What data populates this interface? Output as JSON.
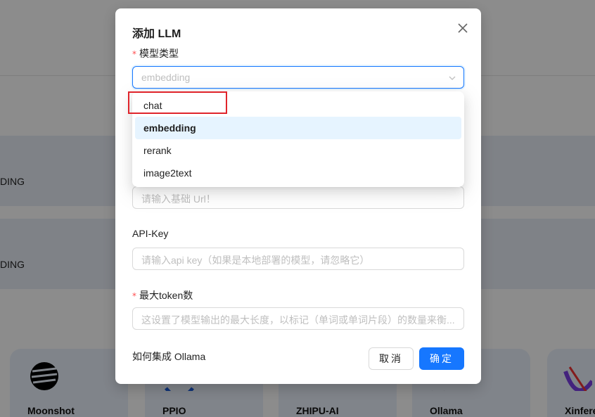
{
  "background": {
    "row_labels": [
      "DING",
      "DING"
    ],
    "cards": [
      {
        "name": "Moonshot",
        "logo": "moonshot-logo"
      },
      {
        "name": "PPIO",
        "logo": "ppio-logo"
      },
      {
        "name": "ZHIPU-AI",
        "logo": "zhipu-logo"
      },
      {
        "name": "Ollama",
        "logo": "ollama-logo"
      },
      {
        "name": "Xinfere",
        "logo": "xinference-logo"
      }
    ]
  },
  "modal": {
    "title": "添加 LLM",
    "model_type": {
      "label": "模型类型",
      "required_mark": "*",
      "value": "embedding",
      "options": [
        "chat",
        "embedding",
        "rerank",
        "image2text"
      ],
      "selected": "embedding"
    },
    "base_url": {
      "placeholder": "请输入基础 Url！"
    },
    "api_key": {
      "label": "API-Key",
      "placeholder": "请输入api key（如果是本地部署的模型，请忽略它）"
    },
    "max_tokens": {
      "label": "最大token数",
      "required_mark": "*",
      "placeholder": "这设置了模型输出的最大长度，以标记（单词或单词片段）的数量来衡..."
    },
    "help_link": "如何集成 Ollama",
    "cancel_label": "取消",
    "ok_label": "确定"
  },
  "colors": {
    "primary": "#1677ff",
    "highlight": "#e0242b",
    "required": "#ff4d4f"
  }
}
